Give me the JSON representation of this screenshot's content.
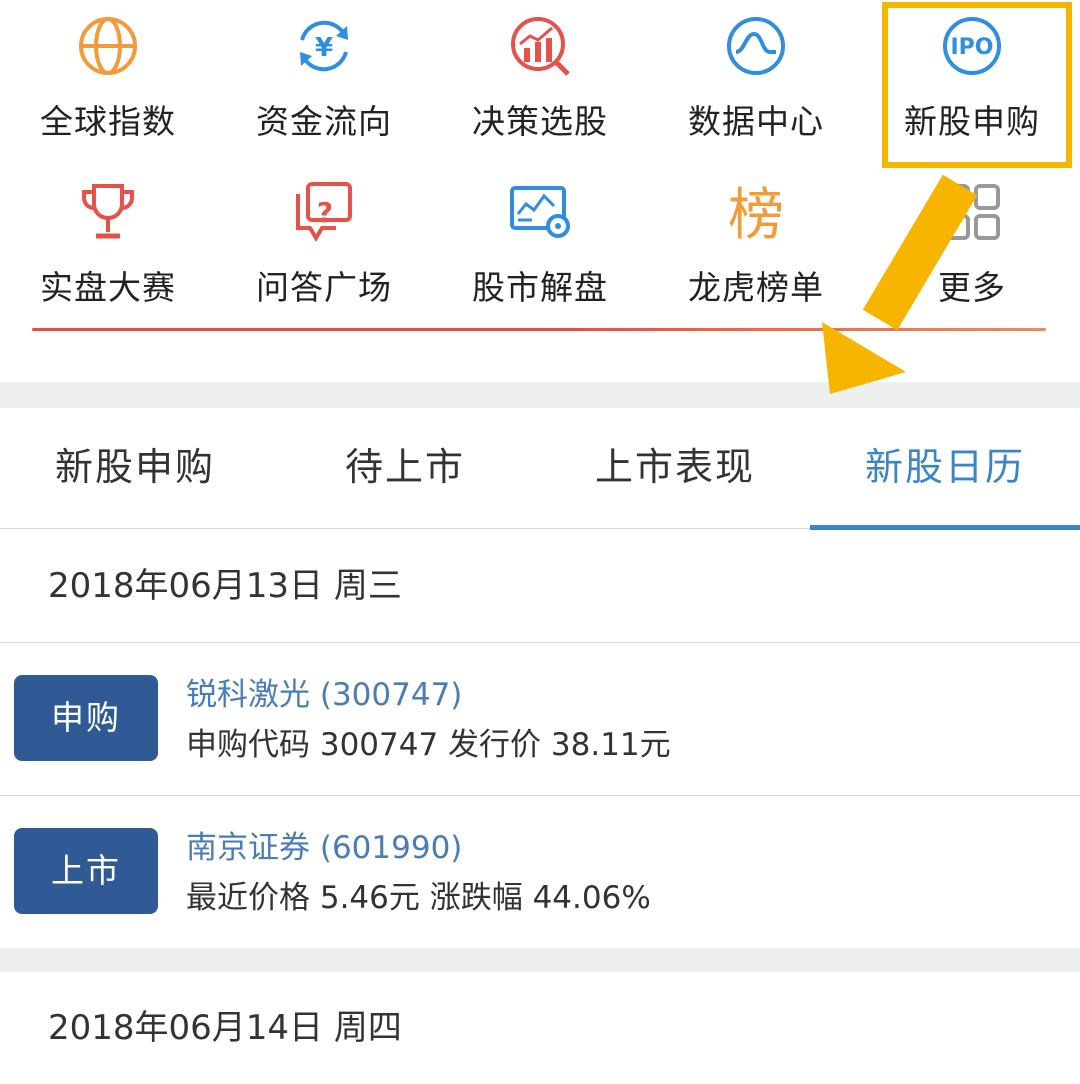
{
  "grid": {
    "items": [
      {
        "label": "全球指数",
        "icon": "globe-icon",
        "color": "#f29b38"
      },
      {
        "label": "资金流向",
        "icon": "yuan-flow-icon",
        "color": "#2f8ee0"
      },
      {
        "label": "决策选股",
        "icon": "decision-chart-icon",
        "color": "#e8504a"
      },
      {
        "label": "数据中心",
        "icon": "data-wave-icon",
        "color": "#2f8ee0"
      },
      {
        "label": "新股申购",
        "icon": "ipo-icon",
        "icon_text": "IPO",
        "color": "#2f8ee0"
      },
      {
        "label": "实盘大赛",
        "icon": "trophy-icon",
        "color": "#e8504a"
      },
      {
        "label": "问答广场",
        "icon": "qa-chat-icon",
        "icon_text": "?",
        "color": "#e8504a"
      },
      {
        "label": "股市解盘",
        "icon": "market-analysis-icon",
        "color": "#2f8ee0"
      },
      {
        "label": "龙虎榜单",
        "icon": "ranking-icon",
        "icon_text": "榜",
        "color": "#f29b38"
      },
      {
        "label": "更多",
        "icon": "more-grid-icon",
        "color": "#999999"
      }
    ]
  },
  "tabs": {
    "items": [
      "新股申购",
      "待上市",
      "上市表现",
      "新股日历"
    ],
    "active": "新股日历",
    "active_color": "#3a84c9"
  },
  "calendar": {
    "day1": {
      "date": "2018年06月13日 周三",
      "entries": [
        {
          "badge": "申购",
          "name": "锐科激光 (300747)",
          "info": "申购代码 300747 发行价 38.11元"
        },
        {
          "badge": "上市",
          "name": "南京证券 (601990)",
          "info": "最近价格 5.46元 涨跌幅 44.06%"
        }
      ]
    },
    "day2": {
      "date": "2018年06月14日 周四"
    }
  },
  "colors": {
    "badge_bg": "#2f5a96",
    "stock_name": "#4a7db5",
    "highlight": "#f7b500"
  }
}
